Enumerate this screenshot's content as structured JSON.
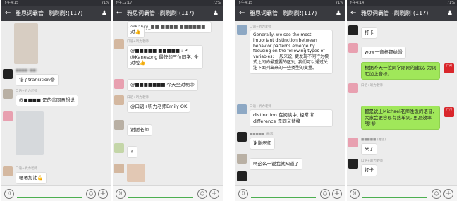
{
  "common": {
    "chat_title": "雅思词霸管~刷刷刷!(117)",
    "back_icon": "←",
    "group_icon": "group-member-icon",
    "voice_label": "))",
    "emoji_label": "☺",
    "plus_label": "+"
  },
  "phone1": {
    "time": "下午4:15",
    "status_right": "71%",
    "messages": [
      {
        "text": "错了transition😁"
      },
      {
        "text": "@■■■■ 是的😉同意想说"
      },
      {
        "text": "嗯嗯加油💪"
      }
    ],
    "names": [
      "口语+听力老师",
      "口语+听力老师"
    ]
  },
  "phone2": {
    "time": "下午12:17",
    "status_right": "72%",
    "messages": [
      {
        "text": "@Kahry_■■ ■■■■ ■■■■■■"
      },
      {
        "text": "对👍"
      },
      {
        "text": "@■■■■■ ■■■■■ :-P @Kanesong 最快的三位同学, 全对啦👍"
      },
      {
        "text": "@■■■■■■■ 今天全对啊😉"
      },
      {
        "text": "@口语+听力老师Emily OK"
      },
      {
        "text": "谢谢老师"
      },
      {
        "text": "✌"
      }
    ],
    "names": [
      "口语+听力老师",
      "口语+听力老师"
    ]
  },
  "phone3": {
    "time": "下午4:15",
    "status_right": "71%",
    "messages": [
      {
        "text": "Generally, we see the most important distinction between behavior patterns emerge by focusing on the following types of variables: 一般来说, 更发现不同行为模式之间的最重要的区别, 我们可以通过关注下面列出来的一些类型的变量。"
      },
      {
        "text": "distinction 在阅读中, 经常 和 difference 是同义替换"
      },
      {
        "text": "谢谢老师"
      },
      {
        "text": "啊这么一说我就知道了"
      }
    ],
    "names": [
      "口语+听力老师",
      "口语+听力老师",
      "■■■■■ (雅思)"
    ]
  },
  "phone4": {
    "time": "下午4:14",
    "status_right": "71%",
    "messages": [
      {
        "text": "打卡"
      },
      {
        "text": "wow一音标都给滑"
      },
      {
        "text": "根据昨天一位同学刚刚的建议, 为词汇加上音标。"
      },
      {
        "text": "都是说上Michael老师晚饭的语音, 大家会更容易有熟单词, 更高效率哦!😁"
      },
      {
        "text": "来了"
      },
      {
        "text": "打卡"
      }
    ],
    "names": [
      "口语+听力老师",
      "■■■■■ (雅思)",
      "口语+听力老师"
    ]
  }
}
